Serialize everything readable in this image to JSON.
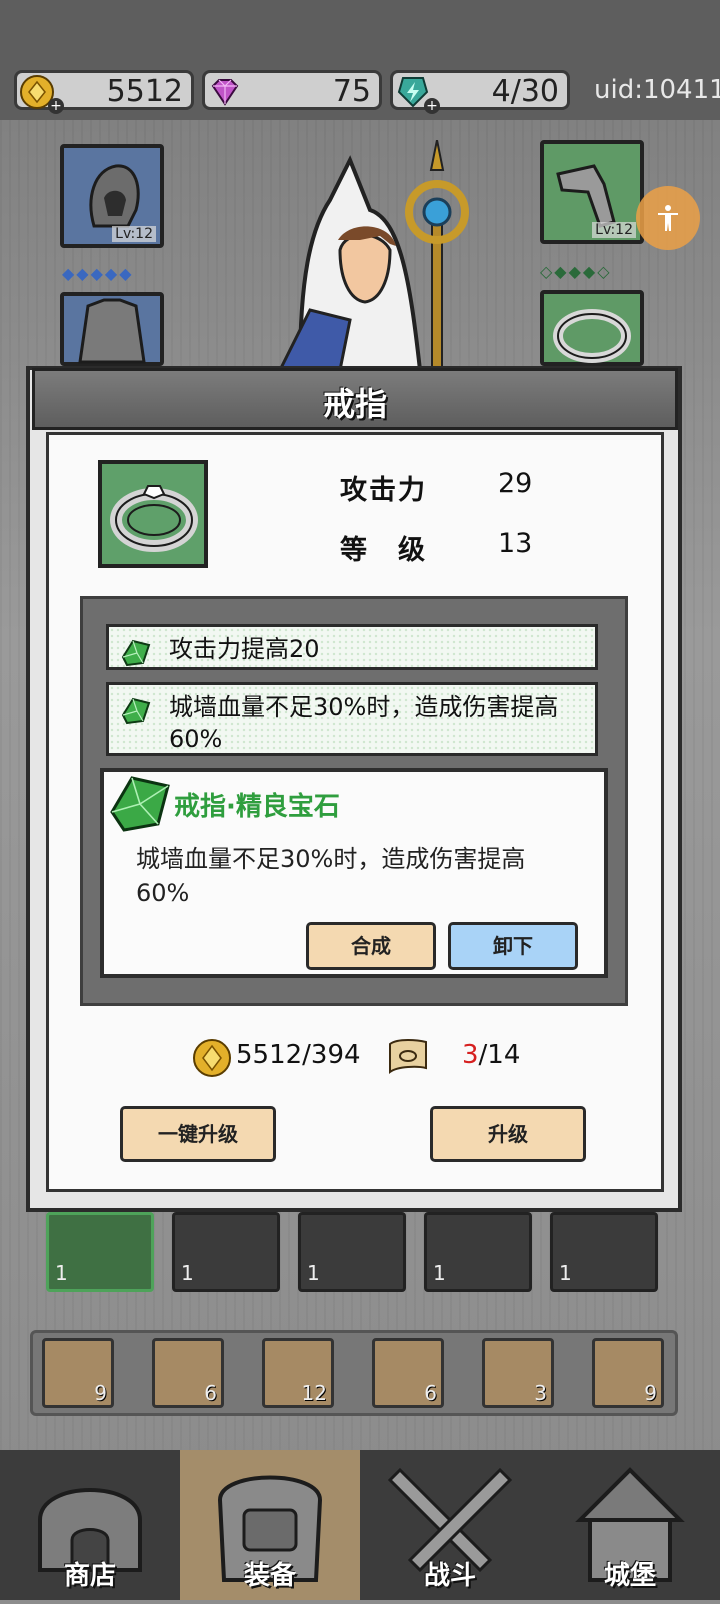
{
  "top_bar": {
    "gold": "5512",
    "gems": "75",
    "energy": "4/30",
    "uid": "uid:10411",
    "plus_symbol": "+"
  },
  "equipment": {
    "slot_left_level": "Lv:12",
    "slot_right_level": "Lv:12",
    "left_gems": "◆◆◆◆◆",
    "right_gems": "◇◆◆◆◇"
  },
  "dialog": {
    "title": "戒指",
    "stats": [
      {
        "label": "攻击力",
        "value": "29"
      },
      {
        "label": "等　级",
        "value": "13"
      }
    ],
    "effects": [
      {
        "text": "攻击力提高20"
      },
      {
        "text": "城墙血量不足30%时，造成伤害提高60%"
      }
    ],
    "gem_card": {
      "title": "戒指·精良宝石",
      "description": "城墙血量不足30%时，造成伤害提高60%",
      "combine_label": "合成",
      "unequip_label": "卸下"
    },
    "cost": {
      "gold": "5512/394",
      "scroll_have": "3",
      "scroll_need": "/14"
    },
    "one_click_upgrade_label": "一键升级",
    "upgrade_label": "升级"
  },
  "inventory": [
    {
      "count": "1"
    },
    {
      "count": "1"
    },
    {
      "count": "1"
    },
    {
      "count": "1"
    },
    {
      "count": "1"
    }
  ],
  "scrolls": [
    {
      "count": "9"
    },
    {
      "count": "6"
    },
    {
      "count": "12"
    },
    {
      "count": "6"
    },
    {
      "count": "3"
    },
    {
      "count": "9"
    }
  ],
  "nav": [
    {
      "label": "商店"
    },
    {
      "label": "装备"
    },
    {
      "label": "战斗"
    },
    {
      "label": "城堡"
    }
  ],
  "colors": {
    "accent_green": "#2f9e3e",
    "cost_red": "#d62020",
    "button_tan": "#f4d9b1",
    "button_blue": "#a9d3f7"
  }
}
